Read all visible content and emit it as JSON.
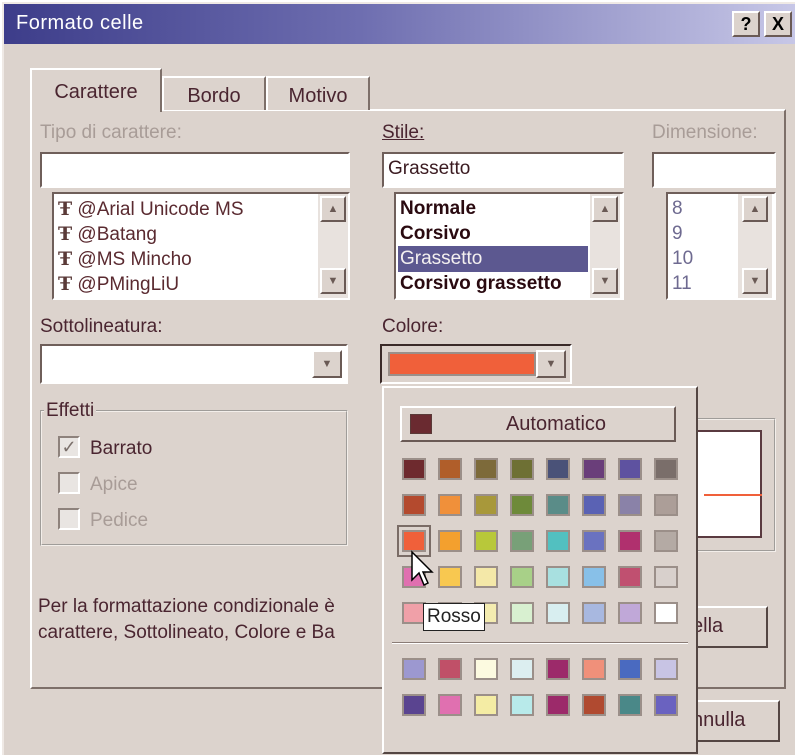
{
  "dialog": {
    "title": "Formato celle",
    "help_glyph": "?",
    "close_glyph": "X"
  },
  "tabs": [
    {
      "label": "Carattere",
      "active": true
    },
    {
      "label": "Bordo",
      "active": false
    },
    {
      "label": "Motivo",
      "active": false
    }
  ],
  "font": {
    "label": "Tipo di carattere:",
    "value": "",
    "items": [
      "@Arial Unicode MS",
      "@Batang",
      "@MS Mincho",
      "@PMingLiU"
    ],
    "item_icon": "truetype-font-icon"
  },
  "style": {
    "label": "Stile:",
    "value": "Grassetto",
    "items": [
      "Normale",
      "Corsivo",
      "Grassetto",
      "Corsivo grassetto"
    ],
    "selected_index": 2
  },
  "size": {
    "label": "Dimensione:",
    "value": "",
    "items": [
      "8",
      "9",
      "10",
      "11"
    ]
  },
  "underline": {
    "label": "Sottolineatura:",
    "value": ""
  },
  "color": {
    "label": "Colore:",
    "value_color": "#f0603a"
  },
  "effects": {
    "label": "Effetti",
    "items": [
      {
        "label": "Barrato",
        "checked": true
      },
      {
        "label": "Apice",
        "checked": false
      },
      {
        "label": "Pedice",
        "checked": false
      }
    ]
  },
  "note": {
    "line1": "Per la formattazione condizionale è",
    "line2": "carattere, Sottolineato, Colore e Ba"
  },
  "buttons": {
    "partial_button": "ella",
    "cancel_partial": "nnulla"
  },
  "palette": {
    "automatic_label": "Automatico",
    "automatic_color": "#6a2a30",
    "tooltip": "Rosso",
    "hovered_index": 16,
    "colors": [
      "#6e2a2e",
      "#b05e2a",
      "#7d6a3a",
      "#6e7034",
      "#4a5278",
      "#6a3e7a",
      "#5e52a0",
      "#7a6e6a",
      "#b44a2e",
      "#f0903a",
      "#a8983a",
      "#6e8a3a",
      "#5a8c88",
      "#5a62b4",
      "#8a82a8",
      "#ac9e98",
      "#f0603a",
      "#f3a02e",
      "#b8c83a",
      "#78a078",
      "#52c0c0",
      "#6a72c0",
      "#b0306e",
      "#b4aaa4",
      "#e070b0",
      "#f8c850",
      "#f4e8a8",
      "#a8d088",
      "#a8e0e0",
      "#88c0e8",
      "#c05070",
      "#d8d0cc",
      "#f0a0a8",
      "#f4c8a0",
      "#f4ecb0",
      "#d8f0d0",
      "#d8eef0",
      "#a8b8e0",
      "#c0a8d8",
      "#ffffff"
    ],
    "custom_colors": [
      "#9c98d0",
      "#c05068",
      "#fcfae0",
      "#dceef0",
      "#9c2a6a",
      "#f0907a",
      "#4a6ac0",
      "#c8c4e4",
      "#5a4490",
      "#e070b0",
      "#f4eca4",
      "#b8eaea",
      "#9c2a6a",
      "#b04a30",
      "#4a8888",
      "#6a62c0"
    ]
  },
  "preview": {
    "strike_color": "#f0603a"
  }
}
